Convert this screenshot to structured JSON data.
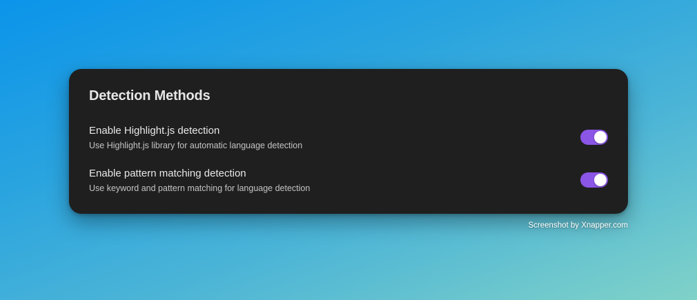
{
  "panel": {
    "title": "Detection Methods",
    "settings": [
      {
        "label": "Enable Highlight.js detection",
        "description": "Use Highlight.js library for automatic language detection",
        "enabled": true
      },
      {
        "label": "Enable pattern matching detection",
        "description": "Use keyword and pattern matching for language detection",
        "enabled": true
      }
    ]
  },
  "colors": {
    "card_background": "#1f1f1f",
    "toggle_on": "#8b55e6",
    "toggle_knob": "#ffffff"
  },
  "watermark": {
    "text": "Screenshot by Xnapper.com"
  }
}
